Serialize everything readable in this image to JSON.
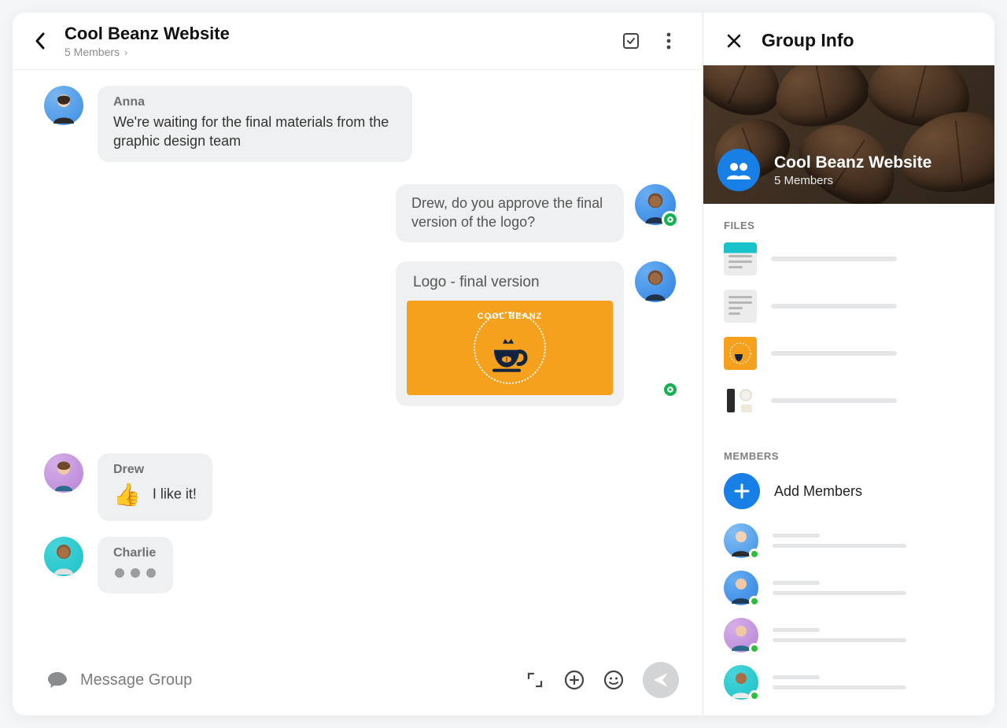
{
  "header": {
    "title": "Cool Beanz Website",
    "subtitle": "5 Members"
  },
  "messages": {
    "anna": {
      "name": "Anna",
      "text": "We're waiting for the final materials from the graphic design team"
    },
    "approve": {
      "text": "Drew, do you approve the final version of the logo?"
    },
    "logo_card": {
      "title": "Logo - final version",
      "logo_text": "COOL BEANZ"
    },
    "drew": {
      "name": "Drew",
      "thumb": "👍",
      "text": "I like it!"
    },
    "charlie": {
      "name": "Charlie"
    }
  },
  "composer": {
    "placeholder": "Message Group"
  },
  "side": {
    "title": "Group Info",
    "cover": {
      "title": "Cool Beanz Website",
      "subtitle": "5 Members"
    },
    "files_heading": "FILES",
    "members_heading": "MEMBERS",
    "add_members": "Add Members"
  }
}
